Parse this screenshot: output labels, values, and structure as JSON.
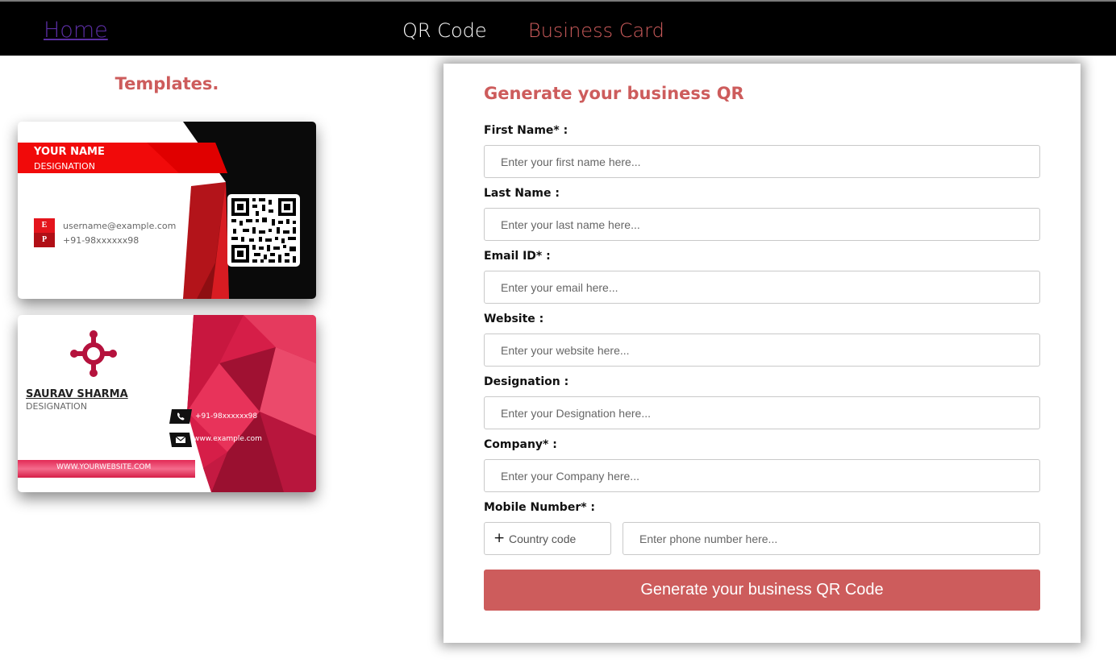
{
  "nav": {
    "home": "Home",
    "qr_code": "QR Code",
    "business_card": "Business Card"
  },
  "templates": {
    "title": "Templates.",
    "card1": {
      "name": "YOUR NAME",
      "designation": "DESIGNATION",
      "badge_e": "E",
      "badge_p": "P",
      "email": "username@example.com",
      "phone": "+91-98xxxxxx98"
    },
    "card2": {
      "name": "SAURAV SHARMA",
      "designation": "DESIGNATION",
      "phone": "+91-98xxxxxx98",
      "web": "www.example.com",
      "website": "WWW.YOURWEBSITE.COM"
    }
  },
  "form": {
    "title": "Generate your business QR",
    "fields": {
      "first_name": {
        "label": "First Name* :",
        "placeholder": "Enter your first name here..."
      },
      "last_name": {
        "label": "Last Name :",
        "placeholder": "Enter your last name here..."
      },
      "email": {
        "label": "Email ID* :",
        "placeholder": "Enter your email here..."
      },
      "website": {
        "label": "Website :",
        "placeholder": "Enter your website here..."
      },
      "designation": {
        "label": "Designation :",
        "placeholder": "Enter your Designation here..."
      },
      "company": {
        "label": "Company* :",
        "placeholder": "Enter your Company here..."
      },
      "mobile": {
        "label": "Mobile Number* :",
        "country_prefix": "+",
        "country_placeholder": "Country code",
        "placeholder": "Enter phone number here..."
      }
    },
    "submit_label": "Generate your business QR Code"
  },
  "colors": {
    "accent": "#cd5c5c",
    "nav_bg": "#000000",
    "home_link": "#5b2ea3",
    "card_red": "#e4141c",
    "card_crimson": "#d61e48"
  }
}
